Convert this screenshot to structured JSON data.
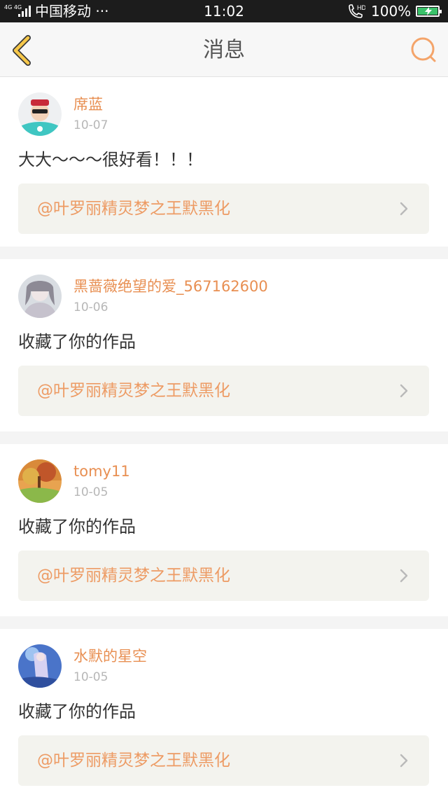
{
  "status_bar": {
    "network": "4G 4G",
    "carrier": "中国移动 ···",
    "time": "11:02",
    "hd": "HD",
    "battery": "100%",
    "battery_color": "#3ac26a"
  },
  "nav": {
    "title": "消息",
    "back_icon": "chevron-left-icon",
    "search_icon": "search-icon",
    "accent": "#f7c84a"
  },
  "messages": [
    {
      "username": "席蓝",
      "date": "10-07",
      "text": "大大～～～很好看！！！",
      "reference": "@叶罗丽精灵梦之王默黑化"
    },
    {
      "username": "黑蔷薇绝望的爱_567162600",
      "date": "10-06",
      "text": "收藏了你的作品",
      "reference": "@叶罗丽精灵梦之王默黑化"
    },
    {
      "username": "tomy11",
      "date": "10-05",
      "text": "收藏了你的作品",
      "reference": "@叶罗丽精灵梦之王默黑化"
    },
    {
      "username": "水默的星空",
      "date": "10-05",
      "text": "收藏了你的作品",
      "reference": "@叶罗丽精灵梦之王默黑化"
    }
  ]
}
